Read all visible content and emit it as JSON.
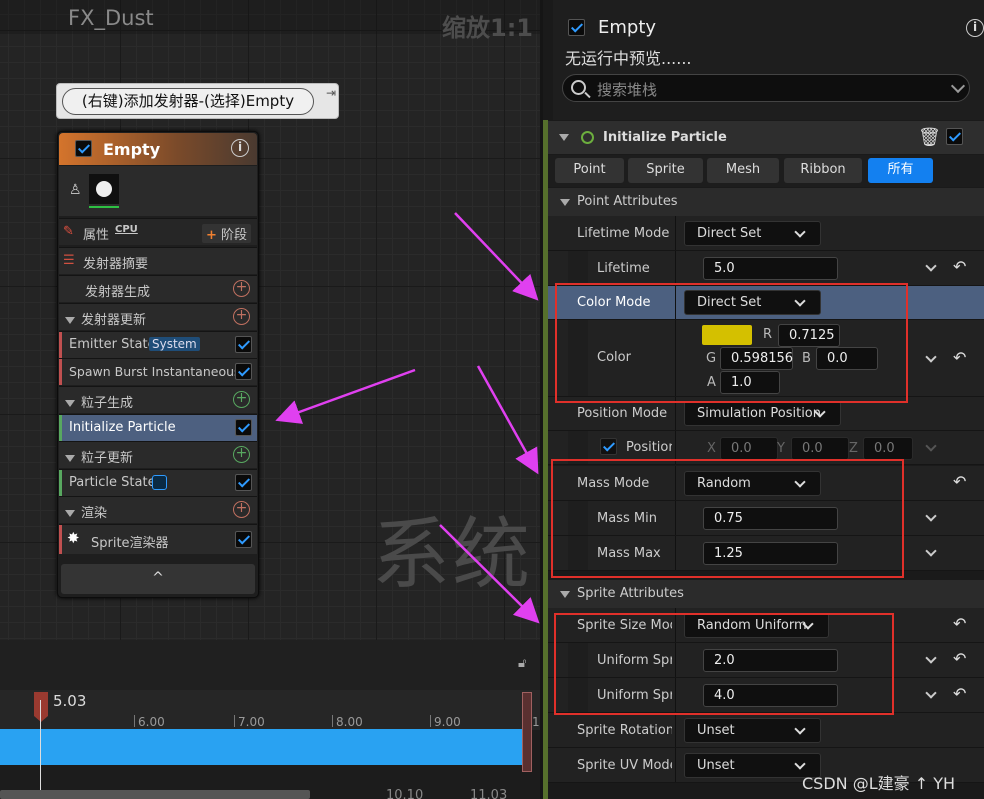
{
  "graph": {
    "title": "FX_Dust",
    "zoom": "缩放1:1",
    "watermark": "系统",
    "tooltip": "(右键)添加发射器-(选择)Empty"
  },
  "node": {
    "title": "Empty",
    "props_label": "属性",
    "cpu_label": "CPU",
    "stage_label": "阶段",
    "rows": {
      "summary": "发射器摘要",
      "spawn": "发射器生成",
      "update": "发射器更新",
      "emitter_state": "Emitter State",
      "emitter_state_chip": "System",
      "spawn_burst": "Spawn Burst Instantaneous",
      "particle_spawn": "粒子生成",
      "init_particle": "Initialize Particle",
      "particle_update": "粒子更新",
      "particle_state": "Particle State",
      "render": "渲染",
      "sprite_renderer": "Sprite渲染器"
    },
    "footer": "^"
  },
  "timeline": {
    "current": "5.03",
    "ticks": [
      "6.00",
      "7.00",
      "8.00",
      "9.00",
      "1"
    ],
    "bottom_ticks": [
      "10.10",
      "11.03"
    ]
  },
  "panel": {
    "title": "Empty",
    "subtitle": "无运行中预览......",
    "search_placeholder": "搜索堆栈",
    "section": "Initialize Particle",
    "tabs": [
      "Point",
      "Sprite",
      "Mesh",
      "Ribbon",
      "所有"
    ],
    "point_attributes": "Point Attributes",
    "lifetime_mode": {
      "label": "Lifetime Mode",
      "value": "Direct Set"
    },
    "lifetime": {
      "label": "Lifetime",
      "value": "5.0"
    },
    "color_mode": {
      "label": "Color Mode",
      "value": "Direct Set"
    },
    "color": {
      "label": "Color",
      "r_label": "R",
      "r": "0.7125",
      "g_label": "G",
      "g": "0.598156",
      "b_label": "B",
      "b": "0.0",
      "a_label": "A",
      "a": "1.0",
      "swatch": "#d4c000"
    },
    "position_mode": {
      "label": "Position Mode",
      "value": "Simulation Position"
    },
    "position": {
      "label": "Positior",
      "x_label": "X",
      "x": "0.0",
      "y_label": "Y",
      "y": "0.0",
      "z_label": "Z",
      "z": "0.0"
    },
    "mass_mode": {
      "label": "Mass Mode",
      "value": "Random"
    },
    "mass_min": {
      "label": "Mass Min",
      "value": "0.75"
    },
    "mass_max": {
      "label": "Mass Max",
      "value": "1.25"
    },
    "sprite_attributes": "Sprite Attributes",
    "sprite_size_mode": {
      "label": "Sprite Size Mode",
      "value": "Random Uniform"
    },
    "uniform_min": {
      "label": "Uniform Sprite Size Min",
      "value": "2.0"
    },
    "uniform_max": {
      "label": "Uniform Sprite Size Max",
      "value": "4.0"
    },
    "sprite_rotation": {
      "label": "Sprite Rotation Mode",
      "value": "Unset"
    },
    "sprite_uv": {
      "label": "Sprite UV Mode",
      "value": "Unset"
    }
  },
  "credit": "CSDN @L建豪 ↑ YH",
  "colors": {
    "accent": "#1380f0",
    "highlight": "#e0302a",
    "arrow": "#e040f0"
  }
}
